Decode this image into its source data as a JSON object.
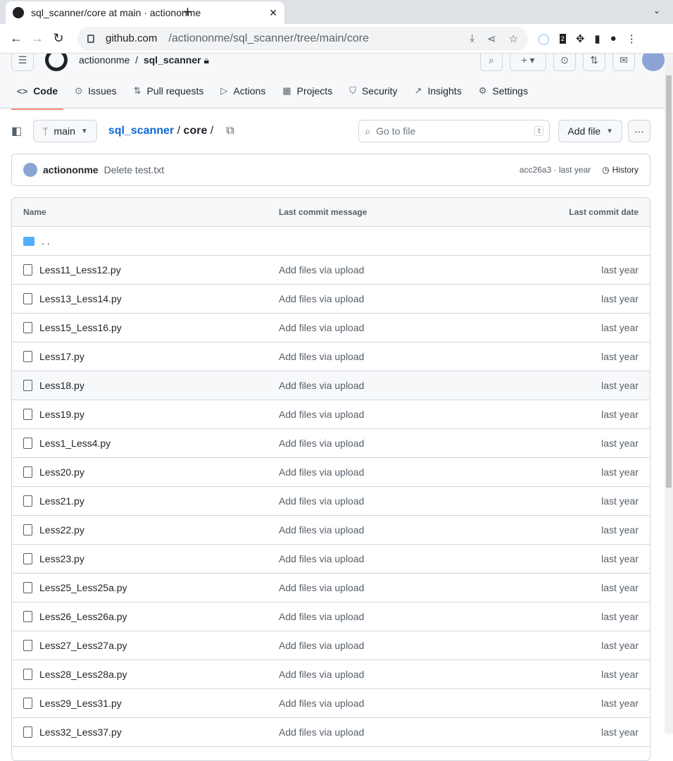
{
  "browser": {
    "tab_title": "sql_scanner/core at main · actiononme",
    "url_host": "github.com",
    "url_path": "/actiononme/sql_scanner/tree/main/core",
    "ext_badge": "2"
  },
  "header": {
    "owner": "actiononme",
    "repo": "sql_scanner",
    "nav": [
      "Code",
      "Issues",
      "Pull requests",
      "Actions",
      "Projects",
      "Security",
      "Insights",
      "Settings"
    ]
  },
  "toolbar": {
    "branch": "main",
    "repo_link": "sql_scanner",
    "sep": "/",
    "current": "core",
    "trail": "/",
    "search_placeholder": "Go to file",
    "search_key": "t",
    "add_file": "Add file",
    "more": "···"
  },
  "commit": {
    "author": "actiononme",
    "message": "Delete test.txt",
    "sha_time": "acc26a3 · last year",
    "history": "History"
  },
  "table": {
    "headers": [
      "Name",
      "Last commit message",
      "Last commit date"
    ],
    "parent": ". .",
    "rows": [
      [
        "Less11_Less12.py",
        "Add files via upload",
        "last year"
      ],
      [
        "Less13_Less14.py",
        "Add files via upload",
        "last year"
      ],
      [
        "Less15_Less16.py",
        "Add files via upload",
        "last year"
      ],
      [
        "Less17.py",
        "Add files via upload",
        "last year"
      ],
      [
        "Less18.py",
        "Add files via upload",
        "last year"
      ],
      [
        "Less19.py",
        "Add files via upload",
        "last year"
      ],
      [
        "Less1_Less4.py",
        "Add files via upload",
        "last year"
      ],
      [
        "Less20.py",
        "Add files via upload",
        "last year"
      ],
      [
        "Less21.py",
        "Add files via upload",
        "last year"
      ],
      [
        "Less22.py",
        "Add files via upload",
        "last year"
      ],
      [
        "Less23.py",
        "Add files via upload",
        "last year"
      ],
      [
        "Less25_Less25a.py",
        "Add files via upload",
        "last year"
      ],
      [
        "Less26_Less26a.py",
        "Add files via upload",
        "last year"
      ],
      [
        "Less27_Less27a.py",
        "Add files via upload",
        "last year"
      ],
      [
        "Less28_Less28a.py",
        "Add files via upload",
        "last year"
      ],
      [
        "Less29_Less31.py",
        "Add files via upload",
        "last year"
      ],
      [
        "Less32_Less37.py",
        "Add files via upload",
        "last year"
      ]
    ],
    "highlighted_row": 4
  }
}
